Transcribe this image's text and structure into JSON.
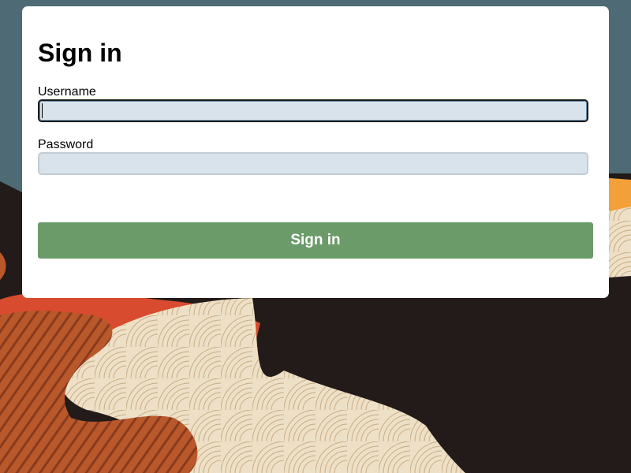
{
  "page": {
    "title": "Sign in"
  },
  "form": {
    "username_label": "Username",
    "username_value": "",
    "password_label": "Password",
    "password_value": "",
    "submit_label": "Sign in"
  },
  "colors": {
    "card_background": "#ffffff",
    "input_background": "#d9e3eb",
    "submit_background": "#6b9b69",
    "submit_text": "#ffffff"
  }
}
